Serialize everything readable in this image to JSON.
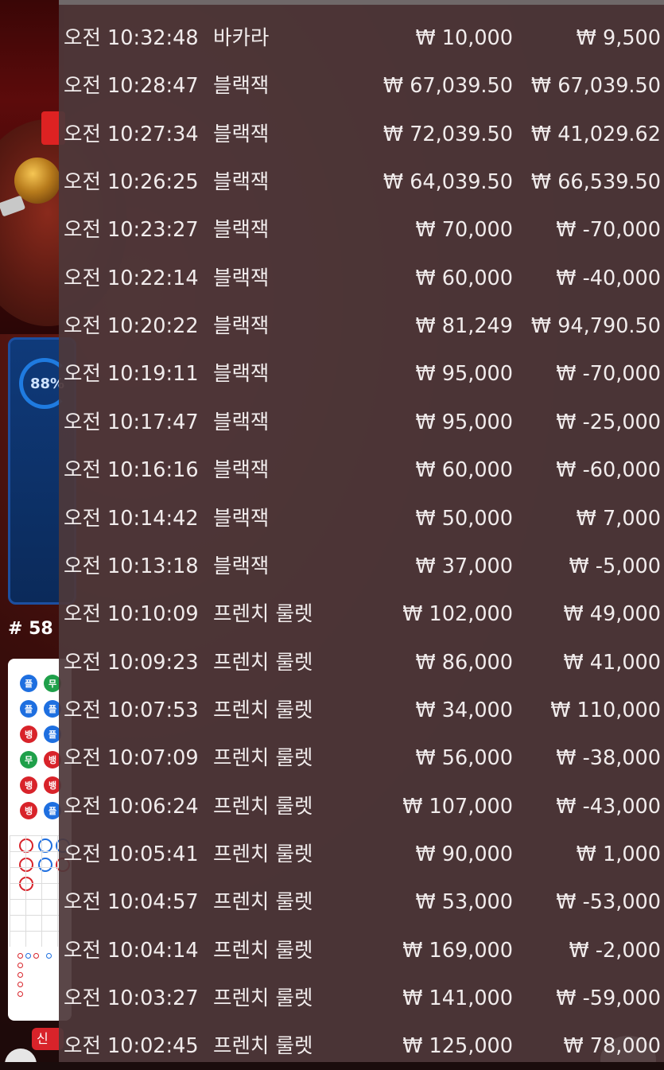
{
  "background": {
    "progress_percent_label": "88%",
    "round_label": "# 58",
    "new_badge_label": "신",
    "roadmap_beads": [
      [
        "플",
        "무"
      ],
      [
        "플",
        "플"
      ],
      [
        "뱅",
        "플"
      ],
      [
        "무",
        "뱅"
      ],
      [
        "뱅",
        "뱅"
      ],
      [
        "뱅",
        "플"
      ]
    ]
  },
  "history": {
    "currency_symbol": "₩",
    "rows": [
      {
        "time": "오전 10:32:48",
        "game": "바카라",
        "bet": "₩ 10,000",
        "win": "₩ 9,500"
      },
      {
        "time": "오전 10:28:47",
        "game": "블랙잭",
        "bet": "₩ 67,039.50",
        "win": "₩ 67,039.50"
      },
      {
        "time": "오전 10:27:34",
        "game": "블랙잭",
        "bet": "₩ 72,039.50",
        "win": "₩ 41,029.62"
      },
      {
        "time": "오전 10:26:25",
        "game": "블랙잭",
        "bet": "₩ 64,039.50",
        "win": "₩ 66,539.50"
      },
      {
        "time": "오전 10:23:27",
        "game": "블랙잭",
        "bet": "₩ 70,000",
        "win": "₩ -70,000"
      },
      {
        "time": "오전 10:22:14",
        "game": "블랙잭",
        "bet": "₩ 60,000",
        "win": "₩ -40,000"
      },
      {
        "time": "오전 10:20:22",
        "game": "블랙잭",
        "bet": "₩ 81,249",
        "win": "₩ 94,790.50"
      },
      {
        "time": "오전 10:19:11",
        "game": "블랙잭",
        "bet": "₩ 95,000",
        "win": "₩ -70,000"
      },
      {
        "time": "오전 10:17:47",
        "game": "블랙잭",
        "bet": "₩ 95,000",
        "win": "₩ -25,000"
      },
      {
        "time": "오전 10:16:16",
        "game": "블랙잭",
        "bet": "₩ 60,000",
        "win": "₩ -60,000"
      },
      {
        "time": "오전 10:14:42",
        "game": "블랙잭",
        "bet": "₩ 50,000",
        "win": "₩ 7,000"
      },
      {
        "time": "오전 10:13:18",
        "game": "블랙잭",
        "bet": "₩ 37,000",
        "win": "₩ -5,000"
      },
      {
        "time": "오전 10:10:09",
        "game": "프렌치 룰렛",
        "bet": "₩ 102,000",
        "win": "₩ 49,000"
      },
      {
        "time": "오전 10:09:23",
        "game": "프렌치 룰렛",
        "bet": "₩ 86,000",
        "win": "₩ 41,000"
      },
      {
        "time": "오전 10:07:53",
        "game": "프렌치 룰렛",
        "bet": "₩ 34,000",
        "win": "₩ 110,000"
      },
      {
        "time": "오전 10:07:09",
        "game": "프렌치 룰렛",
        "bet": "₩ 56,000",
        "win": "₩ -38,000"
      },
      {
        "time": "오전 10:06:24",
        "game": "프렌치 룰렛",
        "bet": "₩ 107,000",
        "win": "₩ -43,000"
      },
      {
        "time": "오전 10:05:41",
        "game": "프렌치 룰렛",
        "bet": "₩ 90,000",
        "win": "₩ 1,000"
      },
      {
        "time": "오전 10:04:57",
        "game": "프렌치 룰렛",
        "bet": "₩ 53,000",
        "win": "₩ -53,000"
      },
      {
        "time": "오전 10:04:14",
        "game": "프렌치 룰렛",
        "bet": "₩ 169,000",
        "win": "₩ -2,000"
      },
      {
        "time": "오전 10:03:27",
        "game": "프렌치 룰렛",
        "bet": "₩ 141,000",
        "win": "₩ -59,000"
      },
      {
        "time": "오전 10:02:45",
        "game": "프렌치 룰렛",
        "bet": "₩ 125,000",
        "win": "₩ 78,000"
      }
    ]
  }
}
